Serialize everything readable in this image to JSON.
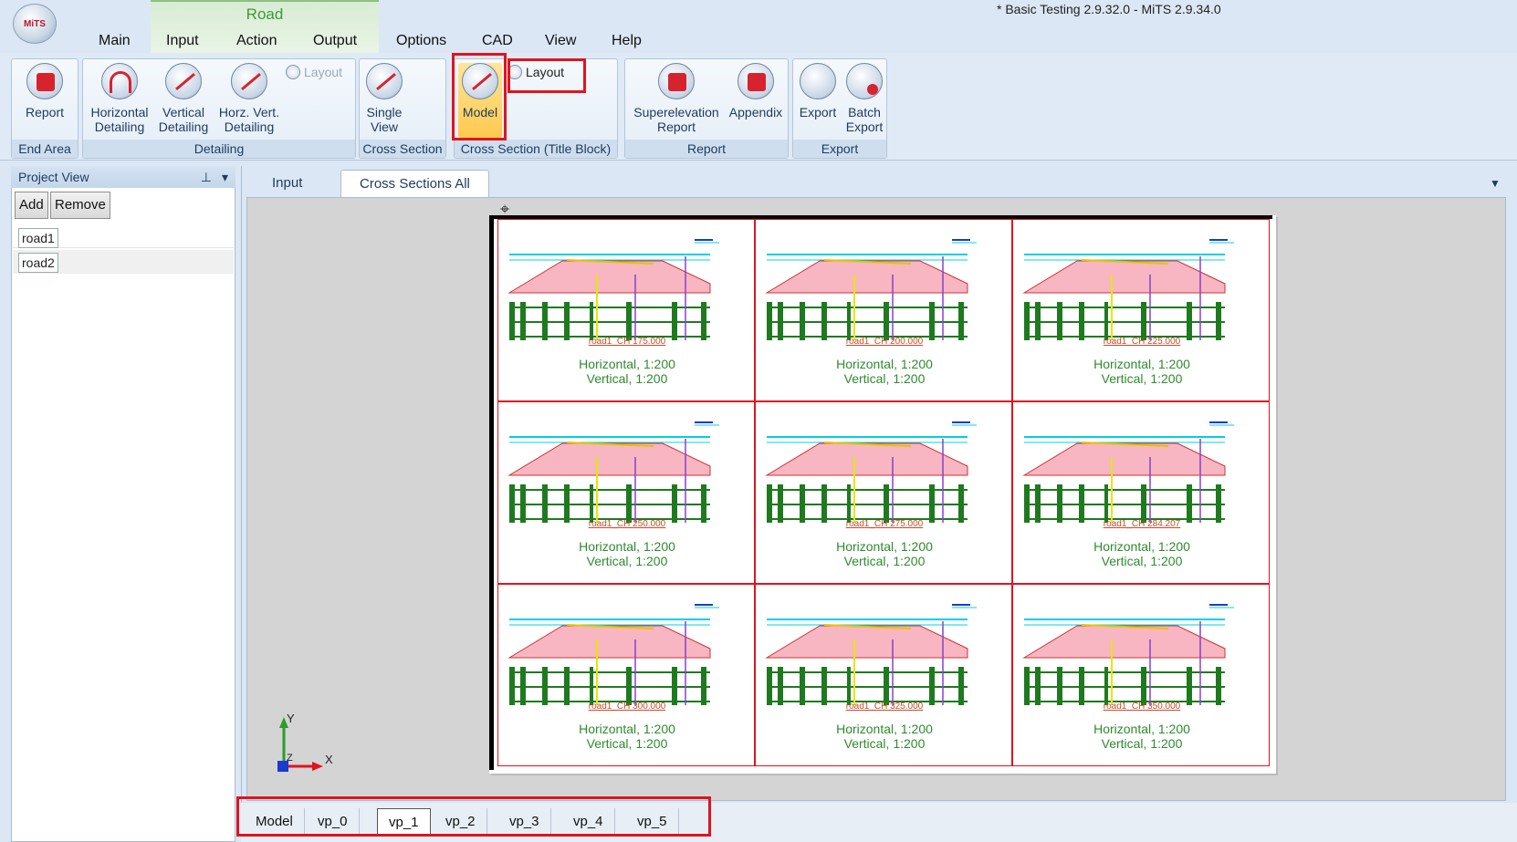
{
  "window": {
    "title": "* Basic Testing 2.9.32.0 - MiTS 2.9.34.0",
    "app_logo": "MiTS"
  },
  "context_tab": {
    "label": "Road"
  },
  "menu": [
    "Main",
    "Input",
    "Action",
    "Output",
    "Options",
    "CAD",
    "View",
    "Help"
  ],
  "ribbon": {
    "end_area": {
      "label": "End Area",
      "report": "Report"
    },
    "detailing": {
      "label": "Detailing",
      "horizontal": "Horizontal\nDetailing",
      "vertical": "Vertical\nDetailing",
      "horz_vert": "Horz. Vert.\nDetailing",
      "layout": "Layout"
    },
    "cross_section": {
      "label": "Cross Section",
      "single_view": "Single\nView"
    },
    "cross_section_title": {
      "label": "Cross Section (Title Block)",
      "model": "Model",
      "layout": "Layout"
    },
    "report": {
      "label": "Report",
      "superelevation": "Superelevation\nReport",
      "appendix": "Appendix"
    },
    "export": {
      "label": "Export",
      "export": "Export",
      "batch_export": "Batch\nExport"
    }
  },
  "project_view": {
    "title": "Project View",
    "add": "Add",
    "remove": "Remove",
    "items": [
      "road1",
      "road2"
    ]
  },
  "doc_tabs": [
    "Input",
    "Cross Sections All"
  ],
  "sections": [
    {
      "label": "road1_CH 175.000",
      "h": "Horizontal, 1:200",
      "v": "Vertical, 1:200"
    },
    {
      "label": "road1_CH 200.000",
      "h": "Horizontal, 1:200",
      "v": "Vertical, 1:200"
    },
    {
      "label": "road1_CH 225.000",
      "h": "Horizontal, 1:200",
      "v": "Vertical, 1:200"
    },
    {
      "label": "road1_CH 250.000",
      "h": "Horizontal, 1:200",
      "v": "Vertical, 1:200"
    },
    {
      "label": "road1_CH 275.000",
      "h": "Horizontal, 1:200",
      "v": "Vertical, 1:200"
    },
    {
      "label": "road1_CH 284.207",
      "h": "Horizontal, 1:200",
      "v": "Vertical, 1:200"
    },
    {
      "label": "road1_CH 300.000",
      "h": "Horizontal, 1:200",
      "v": "Vertical, 1:200"
    },
    {
      "label": "road1_CH 325.000",
      "h": "Horizontal, 1:200",
      "v": "Vertical, 1:200"
    },
    {
      "label": "road1_CH 350.000",
      "h": "Horizontal, 1:200",
      "v": "Vertical, 1:200"
    }
  ],
  "axis": {
    "x": "X",
    "y": "Y",
    "z": "Z"
  },
  "layout_tabs": [
    "Model",
    "vp_0",
    "vp_1",
    "vp_2",
    "vp_3",
    "vp_4",
    "vp_5"
  ],
  "colors": {
    "highlight": "#e0141e",
    "fill": "#f7b6c2",
    "grid": "#1f7a1f",
    "cyan": "#00d0e0"
  }
}
